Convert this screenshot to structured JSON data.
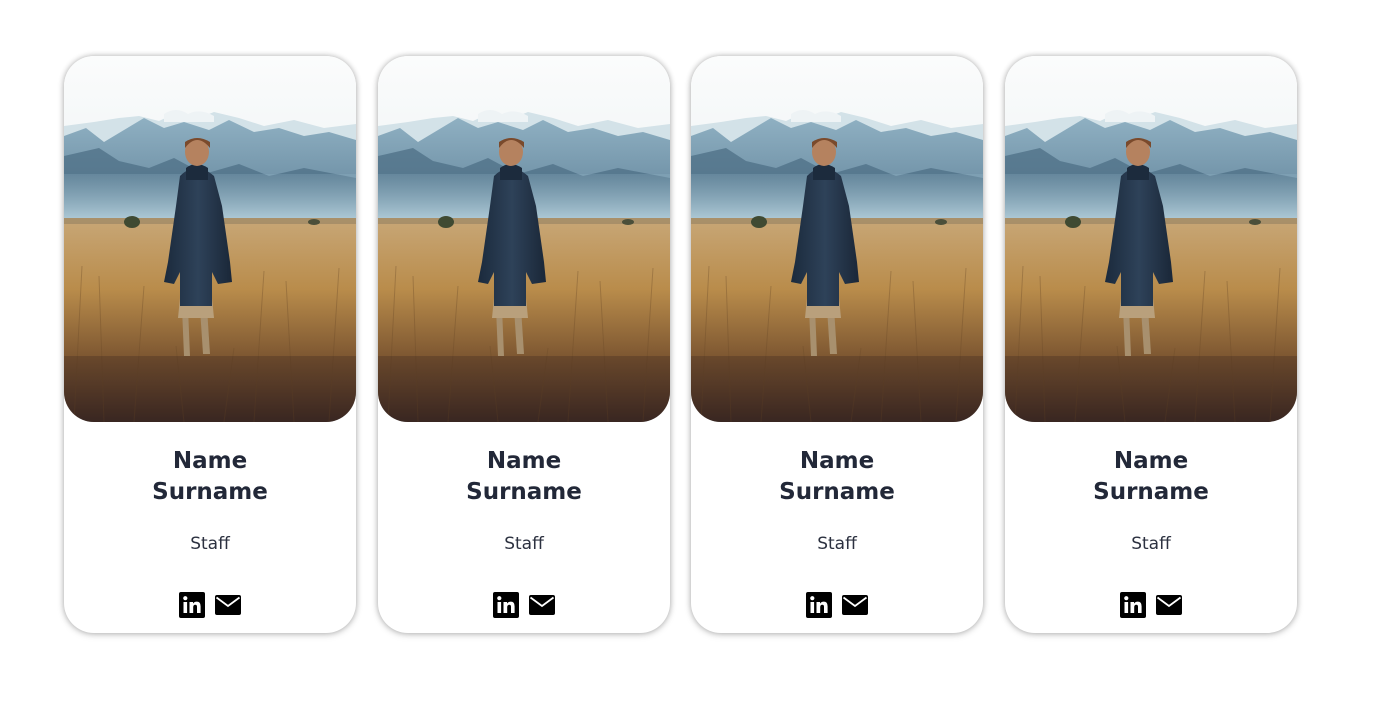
{
  "team": {
    "members": [
      {
        "first_name": "Name",
        "last_name": "Surname",
        "role": "Staff",
        "image": "man-in-wheat-field-mountains",
        "social": [
          "linkedin-icon",
          "envelope-icon"
        ]
      },
      {
        "first_name": "Name",
        "last_name": "Surname",
        "role": "Staff",
        "image": "man-in-wheat-field-mountains",
        "social": [
          "linkedin-icon",
          "envelope-icon"
        ]
      },
      {
        "first_name": "Name",
        "last_name": "Surname",
        "role": "Staff",
        "image": "man-in-wheat-field-mountains",
        "social": [
          "linkedin-icon",
          "envelope-icon"
        ]
      },
      {
        "first_name": "Name",
        "last_name": "Surname",
        "role": "Staff",
        "image": "man-in-wheat-field-mountains",
        "social": [
          "linkedin-icon",
          "envelope-icon"
        ]
      }
    ]
  },
  "colors": {
    "name_text": "#222838",
    "role_text": "#2c3140",
    "icon": "#000000",
    "card_bg": "#ffffff"
  }
}
